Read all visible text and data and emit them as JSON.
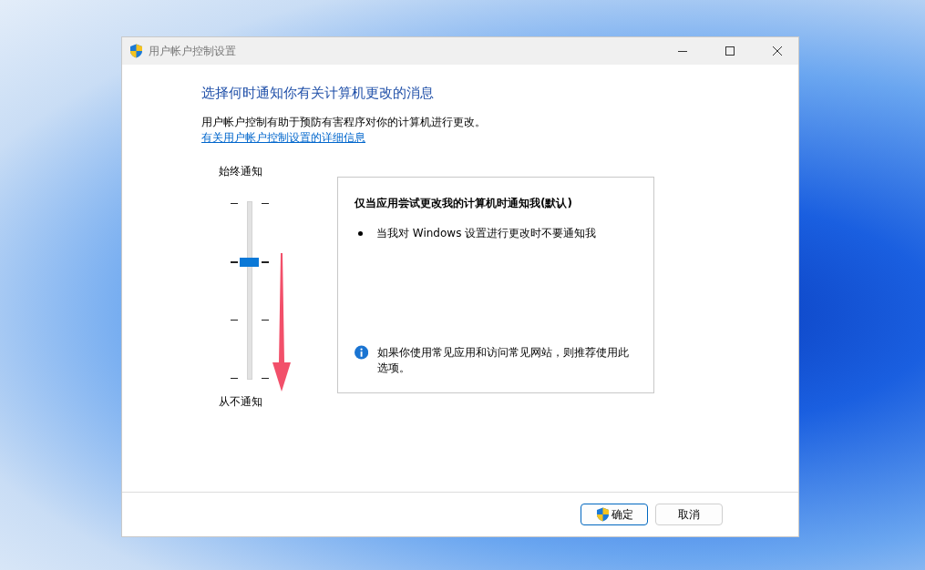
{
  "window": {
    "title": "用户帐户控制设置"
  },
  "heading": "选择何时通知你有关计算机更改的消息",
  "description": "用户帐户控制有助于预防有害程序对你的计算机进行更改。",
  "link": "有关用户帐户控制设置的详细信息",
  "slider": {
    "top_label": "始终通知",
    "bottom_label": "从不通知",
    "stops": [
      {
        "selected": false
      },
      {
        "selected": true
      },
      {
        "selected": false
      },
      {
        "selected": false
      }
    ]
  },
  "info_panel": {
    "title": "仅当应用尝试更改我的计算机时通知我(默认)",
    "bullets": [
      "当我对 Windows 设置进行更改时不要通知我"
    ],
    "note": "如果你使用常见应用和访问常见网站，则推荐使用此选项。"
  },
  "buttons": [
    {
      "label": "确定",
      "kind": "primary"
    },
    {
      "label": "取消",
      "kind": "secondary"
    }
  ]
}
